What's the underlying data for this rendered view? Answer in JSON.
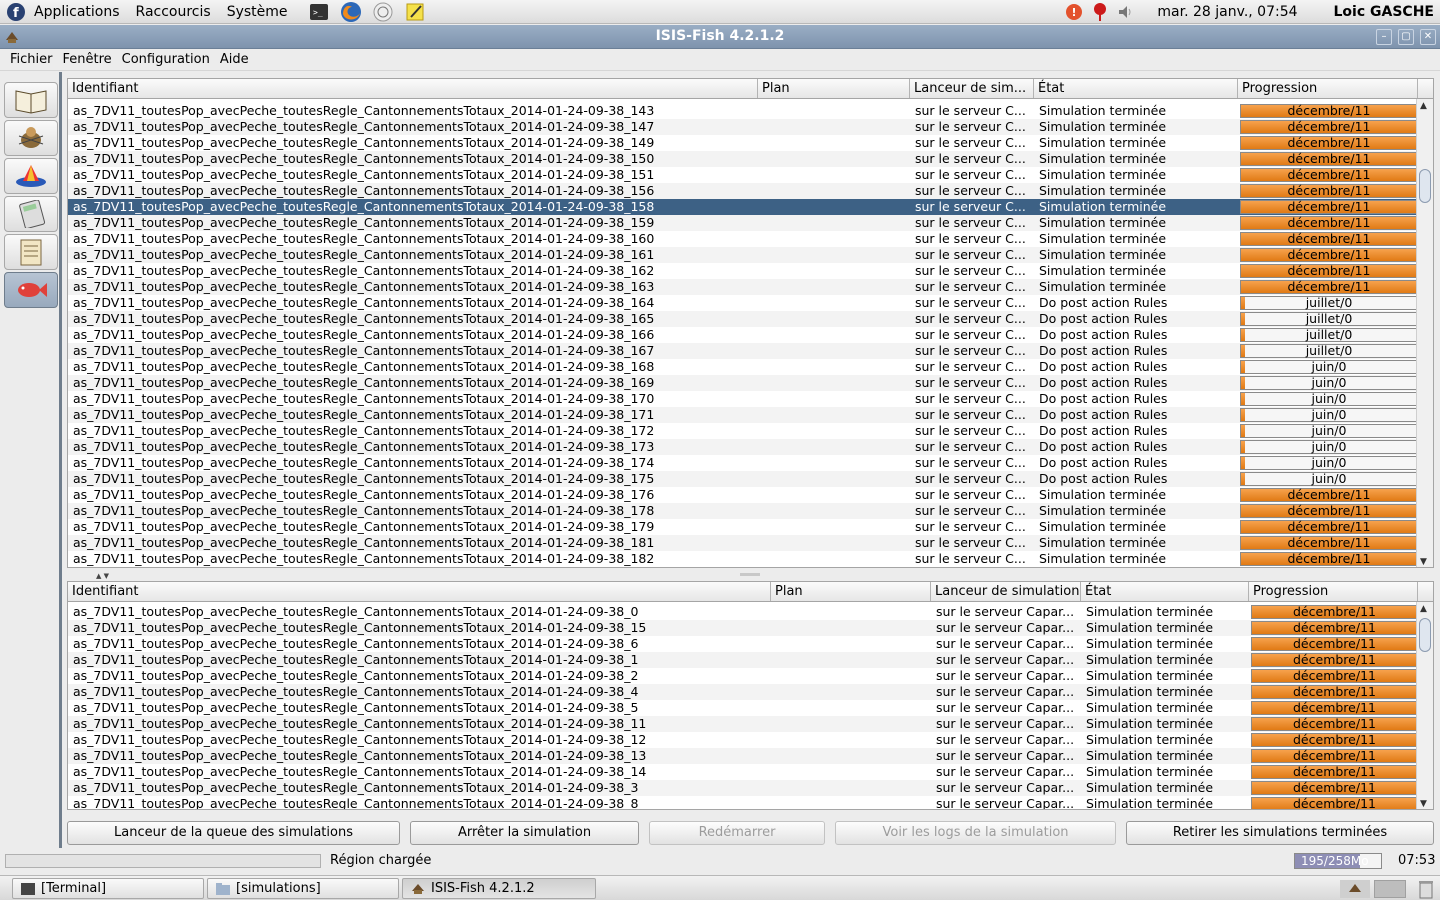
{
  "top_panel": {
    "menus": [
      "Applications",
      "Raccourcis",
      "Système"
    ],
    "clock": "mar. 28 janv., 07:54",
    "user": "Loic GASCHE"
  },
  "window": {
    "title": "ISIS-Fish 4.2.1.2",
    "menu": [
      "Fichier",
      "Fenêtre",
      "Configuration",
      "Aide"
    ]
  },
  "left_toolbar": [
    "book-icon",
    "spider-icon",
    "chart-3d-icon",
    "calculator-icon",
    "notepad-icon",
    "fish-icon"
  ],
  "queue_table": {
    "columns": [
      "Identifiant",
      "Plan",
      "Lanceur de sim...",
      "État",
      "Progression"
    ],
    "selected_index": 6,
    "rows": [
      {
        "id": "as_7DV11_toutesPop_avecPeche_toutesRegle_CantonnementsTotaux_2014-01-24-09-38_143",
        "plan": "",
        "launcher": "sur le serveur C...",
        "state": "Simulation terminée",
        "progress": "décembre/11",
        "fraction": 1.0
      },
      {
        "id": "as_7DV11_toutesPop_avecPeche_toutesRegle_CantonnementsTotaux_2014-01-24-09-38_147",
        "plan": "",
        "launcher": "sur le serveur C...",
        "state": "Simulation terminée",
        "progress": "décembre/11",
        "fraction": 1.0
      },
      {
        "id": "as_7DV11_toutesPop_avecPeche_toutesRegle_CantonnementsTotaux_2014-01-24-09-38_149",
        "plan": "",
        "launcher": "sur le serveur C...",
        "state": "Simulation terminée",
        "progress": "décembre/11",
        "fraction": 1.0
      },
      {
        "id": "as_7DV11_toutesPop_avecPeche_toutesRegle_CantonnementsTotaux_2014-01-24-09-38_150",
        "plan": "",
        "launcher": "sur le serveur C...",
        "state": "Simulation terminée",
        "progress": "décembre/11",
        "fraction": 1.0
      },
      {
        "id": "as_7DV11_toutesPop_avecPeche_toutesRegle_CantonnementsTotaux_2014-01-24-09-38_151",
        "plan": "",
        "launcher": "sur le serveur C...",
        "state": "Simulation terminée",
        "progress": "décembre/11",
        "fraction": 1.0
      },
      {
        "id": "as_7DV11_toutesPop_avecPeche_toutesRegle_CantonnementsTotaux_2014-01-24-09-38_156",
        "plan": "",
        "launcher": "sur le serveur C...",
        "state": "Simulation terminée",
        "progress": "décembre/11",
        "fraction": 1.0
      },
      {
        "id": "as_7DV11_toutesPop_avecPeche_toutesRegle_CantonnementsTotaux_2014-01-24-09-38_158",
        "plan": "",
        "launcher": "sur le serveur C...",
        "state": "Simulation terminée",
        "progress": "décembre/11",
        "fraction": 1.0
      },
      {
        "id": "as_7DV11_toutesPop_avecPeche_toutesRegle_CantonnementsTotaux_2014-01-24-09-38_159",
        "plan": "",
        "launcher": "sur le serveur C...",
        "state": "Simulation terminée",
        "progress": "décembre/11",
        "fraction": 1.0
      },
      {
        "id": "as_7DV11_toutesPop_avecPeche_toutesRegle_CantonnementsTotaux_2014-01-24-09-38_160",
        "plan": "",
        "launcher": "sur le serveur C...",
        "state": "Simulation terminée",
        "progress": "décembre/11",
        "fraction": 1.0
      },
      {
        "id": "as_7DV11_toutesPop_avecPeche_toutesRegle_CantonnementsTotaux_2014-01-24-09-38_161",
        "plan": "",
        "launcher": "sur le serveur C...",
        "state": "Simulation terminée",
        "progress": "décembre/11",
        "fraction": 1.0
      },
      {
        "id": "as_7DV11_toutesPop_avecPeche_toutesRegle_CantonnementsTotaux_2014-01-24-09-38_162",
        "plan": "",
        "launcher": "sur le serveur C...",
        "state": "Simulation terminée",
        "progress": "décembre/11",
        "fraction": 1.0
      },
      {
        "id": "as_7DV11_toutesPop_avecPeche_toutesRegle_CantonnementsTotaux_2014-01-24-09-38_163",
        "plan": "",
        "launcher": "sur le serveur C...",
        "state": "Simulation terminée",
        "progress": "décembre/11",
        "fraction": 1.0
      },
      {
        "id": "as_7DV11_toutesPop_avecPeche_toutesRegle_CantonnementsTotaux_2014-01-24-09-38_164",
        "plan": "",
        "launcher": "sur le serveur C...",
        "state": "Do post action Rules",
        "progress": "juillet/0",
        "fraction": 0.02
      },
      {
        "id": "as_7DV11_toutesPop_avecPeche_toutesRegle_CantonnementsTotaux_2014-01-24-09-38_165",
        "plan": "",
        "launcher": "sur le serveur C...",
        "state": "Do post action Rules",
        "progress": "juillet/0",
        "fraction": 0.02
      },
      {
        "id": "as_7DV11_toutesPop_avecPeche_toutesRegle_CantonnementsTotaux_2014-01-24-09-38_166",
        "plan": "",
        "launcher": "sur le serveur C...",
        "state": "Do post action Rules",
        "progress": "juillet/0",
        "fraction": 0.02
      },
      {
        "id": "as_7DV11_toutesPop_avecPeche_toutesRegle_CantonnementsTotaux_2014-01-24-09-38_167",
        "plan": "",
        "launcher": "sur le serveur C...",
        "state": "Do post action Rules",
        "progress": "juillet/0",
        "fraction": 0.02
      },
      {
        "id": "as_7DV11_toutesPop_avecPeche_toutesRegle_CantonnementsTotaux_2014-01-24-09-38_168",
        "plan": "",
        "launcher": "sur le serveur C...",
        "state": "Do post action Rules",
        "progress": "juin/0",
        "fraction": 0.02
      },
      {
        "id": "as_7DV11_toutesPop_avecPeche_toutesRegle_CantonnementsTotaux_2014-01-24-09-38_169",
        "plan": "",
        "launcher": "sur le serveur C...",
        "state": "Do post action Rules",
        "progress": "juin/0",
        "fraction": 0.02
      },
      {
        "id": "as_7DV11_toutesPop_avecPeche_toutesRegle_CantonnementsTotaux_2014-01-24-09-38_170",
        "plan": "",
        "launcher": "sur le serveur C...",
        "state": "Do post action Rules",
        "progress": "juin/0",
        "fraction": 0.02
      },
      {
        "id": "as_7DV11_toutesPop_avecPeche_toutesRegle_CantonnementsTotaux_2014-01-24-09-38_171",
        "plan": "",
        "launcher": "sur le serveur C...",
        "state": "Do post action Rules",
        "progress": "juin/0",
        "fraction": 0.02
      },
      {
        "id": "as_7DV11_toutesPop_avecPeche_toutesRegle_CantonnementsTotaux_2014-01-24-09-38_172",
        "plan": "",
        "launcher": "sur le serveur C...",
        "state": "Do post action Rules",
        "progress": "juin/0",
        "fraction": 0.02
      },
      {
        "id": "as_7DV11_toutesPop_avecPeche_toutesRegle_CantonnementsTotaux_2014-01-24-09-38_173",
        "plan": "",
        "launcher": "sur le serveur C...",
        "state": "Do post action Rules",
        "progress": "juin/0",
        "fraction": 0.02
      },
      {
        "id": "as_7DV11_toutesPop_avecPeche_toutesRegle_CantonnementsTotaux_2014-01-24-09-38_174",
        "plan": "",
        "launcher": "sur le serveur C...",
        "state": "Do post action Rules",
        "progress": "juin/0",
        "fraction": 0.02
      },
      {
        "id": "as_7DV11_toutesPop_avecPeche_toutesRegle_CantonnementsTotaux_2014-01-24-09-38_175",
        "plan": "",
        "launcher": "sur le serveur C...",
        "state": "Do post action Rules",
        "progress": "juin/0",
        "fraction": 0.02
      },
      {
        "id": "as_7DV11_toutesPop_avecPeche_toutesRegle_CantonnementsTotaux_2014-01-24-09-38_176",
        "plan": "",
        "launcher": "sur le serveur C...",
        "state": "Simulation terminée",
        "progress": "décembre/11",
        "fraction": 1.0
      },
      {
        "id": "as_7DV11_toutesPop_avecPeche_toutesRegle_CantonnementsTotaux_2014-01-24-09-38_178",
        "plan": "",
        "launcher": "sur le serveur C...",
        "state": "Simulation terminée",
        "progress": "décembre/11",
        "fraction": 1.0
      },
      {
        "id": "as_7DV11_toutesPop_avecPeche_toutesRegle_CantonnementsTotaux_2014-01-24-09-38_179",
        "plan": "",
        "launcher": "sur le serveur C...",
        "state": "Simulation terminée",
        "progress": "décembre/11",
        "fraction": 1.0
      },
      {
        "id": "as_7DV11_toutesPop_avecPeche_toutesRegle_CantonnementsTotaux_2014-01-24-09-38_181",
        "plan": "",
        "launcher": "sur le serveur C...",
        "state": "Simulation terminée",
        "progress": "décembre/11",
        "fraction": 1.0
      },
      {
        "id": "as_7DV11_toutesPop_avecPeche_toutesRegle_CantonnementsTotaux_2014-01-24-09-38_182",
        "plan": "",
        "launcher": "sur le serveur C...",
        "state": "Simulation terminée",
        "progress": "décembre/11",
        "fraction": 1.0
      }
    ]
  },
  "done_table": {
    "columns": [
      "Identifiant",
      "Plan",
      "Lanceur de simulation",
      "État",
      "Progression"
    ],
    "rows": [
      {
        "id": "as_7DV11_toutesPop_avecPeche_toutesRegle_CantonnementsTotaux_2014-01-24-09-38_0",
        "plan": "",
        "launcher": "sur le serveur Capar...",
        "state": "Simulation terminée",
        "progress": "décembre/11",
        "fraction": 1.0
      },
      {
        "id": "as_7DV11_toutesPop_avecPeche_toutesRegle_CantonnementsTotaux_2014-01-24-09-38_15",
        "plan": "",
        "launcher": "sur le serveur Capar...",
        "state": "Simulation terminée",
        "progress": "décembre/11",
        "fraction": 1.0
      },
      {
        "id": "as_7DV11_toutesPop_avecPeche_toutesRegle_CantonnementsTotaux_2014-01-24-09-38_6",
        "plan": "",
        "launcher": "sur le serveur Capar...",
        "state": "Simulation terminée",
        "progress": "décembre/11",
        "fraction": 1.0
      },
      {
        "id": "as_7DV11_toutesPop_avecPeche_toutesRegle_CantonnementsTotaux_2014-01-24-09-38_1",
        "plan": "",
        "launcher": "sur le serveur Capar...",
        "state": "Simulation terminée",
        "progress": "décembre/11",
        "fraction": 1.0
      },
      {
        "id": "as_7DV11_toutesPop_avecPeche_toutesRegle_CantonnementsTotaux_2014-01-24-09-38_2",
        "plan": "",
        "launcher": "sur le serveur Capar...",
        "state": "Simulation terminée",
        "progress": "décembre/11",
        "fraction": 1.0
      },
      {
        "id": "as_7DV11_toutesPop_avecPeche_toutesRegle_CantonnementsTotaux_2014-01-24-09-38_4",
        "plan": "",
        "launcher": "sur le serveur Capar...",
        "state": "Simulation terminée",
        "progress": "décembre/11",
        "fraction": 1.0
      },
      {
        "id": "as_7DV11_toutesPop_avecPeche_toutesRegle_CantonnementsTotaux_2014-01-24-09-38_5",
        "plan": "",
        "launcher": "sur le serveur Capar...",
        "state": "Simulation terminée",
        "progress": "décembre/11",
        "fraction": 1.0
      },
      {
        "id": "as_7DV11_toutesPop_avecPeche_toutesRegle_CantonnementsTotaux_2014-01-24-09-38_11",
        "plan": "",
        "launcher": "sur le serveur Capar...",
        "state": "Simulation terminée",
        "progress": "décembre/11",
        "fraction": 1.0
      },
      {
        "id": "as_7DV11_toutesPop_avecPeche_toutesRegle_CantonnementsTotaux_2014-01-24-09-38_12",
        "plan": "",
        "launcher": "sur le serveur Capar...",
        "state": "Simulation terminée",
        "progress": "décembre/11",
        "fraction": 1.0
      },
      {
        "id": "as_7DV11_toutesPop_avecPeche_toutesRegle_CantonnementsTotaux_2014-01-24-09-38_13",
        "plan": "",
        "launcher": "sur le serveur Capar...",
        "state": "Simulation terminée",
        "progress": "décembre/11",
        "fraction": 1.0
      },
      {
        "id": "as_7DV11_toutesPop_avecPeche_toutesRegle_CantonnementsTotaux_2014-01-24-09-38_14",
        "plan": "",
        "launcher": "sur le serveur Capar...",
        "state": "Simulation terminée",
        "progress": "décembre/11",
        "fraction": 1.0
      },
      {
        "id": "as_7DV11_toutesPop_avecPeche_toutesRegle_CantonnementsTotaux_2014-01-24-09-38_3",
        "plan": "",
        "launcher": "sur le serveur Capar...",
        "state": "Simulation terminée",
        "progress": "décembre/11",
        "fraction": 1.0
      },
      {
        "id": "as_7DV11_toutesPop_avecPeche_toutesRegle_CantonnementsTotaux_2014-01-24-09-38_8",
        "plan": "",
        "launcher": "sur le serveur Capar...",
        "state": "Simulation terminée",
        "progress": "décembre/11",
        "fraction": 1.0
      }
    ]
  },
  "buttons": {
    "queue_launcher": "Lanceur de la queue des simulations",
    "stop": "Arrêter la simulation",
    "restart": "Redémarrer",
    "view_logs": "Voir les logs de la simulation",
    "remove_done": "Retirer les simulations terminées"
  },
  "statusbar": {
    "message": "Région chargée",
    "memory": "195/258Mo",
    "memory_fraction": 0.756,
    "time": "07:53"
  },
  "taskbar": {
    "tasks": [
      "[Terminal]",
      "[simulations]",
      "ISIS-Fish 4.2.1.2"
    ]
  },
  "colors": {
    "selection": "#3d6185",
    "progress_fill": "#e98a2c",
    "titlebar": "#8ca0b9"
  }
}
